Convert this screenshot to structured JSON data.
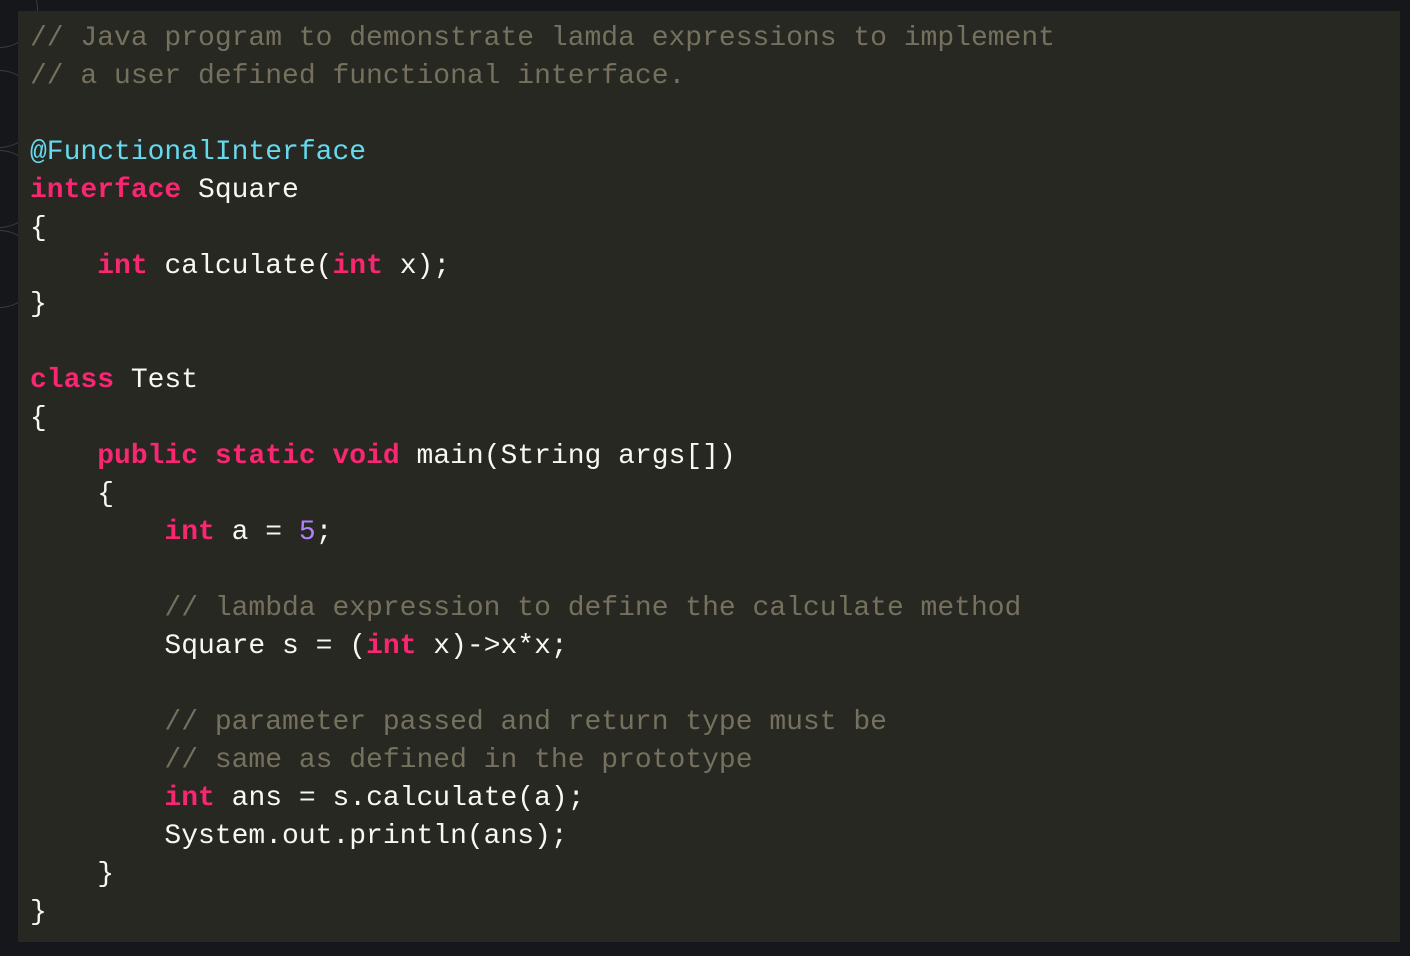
{
  "colors": {
    "background": "#15171a",
    "panel": "#272822",
    "text": "#f8f8f2",
    "comment": "#75715e",
    "keyword": "#f92672",
    "annotation": "#66d9ef",
    "number": "#ae81ff"
  },
  "code": {
    "lines": [
      [
        {
          "t": "comment",
          "s": "// Java program to demonstrate lamda expressions to implement"
        }
      ],
      [
        {
          "t": "comment",
          "s": "// a user defined functional interface."
        }
      ],
      [],
      [
        {
          "t": "annotation",
          "s": "@FunctionalInterface"
        }
      ],
      [
        {
          "t": "keyword",
          "s": "interface"
        },
        {
          "t": "plain",
          "s": " Square"
        }
      ],
      [
        {
          "t": "plain",
          "s": "{"
        }
      ],
      [
        {
          "t": "plain",
          "s": "    "
        },
        {
          "t": "keyword",
          "s": "int"
        },
        {
          "t": "plain",
          "s": " calculate("
        },
        {
          "t": "keyword",
          "s": "int"
        },
        {
          "t": "plain",
          "s": " x);"
        }
      ],
      [
        {
          "t": "plain",
          "s": "}"
        }
      ],
      [],
      [
        {
          "t": "keyword",
          "s": "class"
        },
        {
          "t": "plain",
          "s": " Test"
        }
      ],
      [
        {
          "t": "plain",
          "s": "{"
        }
      ],
      [
        {
          "t": "plain",
          "s": "    "
        },
        {
          "t": "keyword",
          "s": "public"
        },
        {
          "t": "plain",
          "s": " "
        },
        {
          "t": "keyword",
          "s": "static"
        },
        {
          "t": "plain",
          "s": " "
        },
        {
          "t": "keyword",
          "s": "void"
        },
        {
          "t": "plain",
          "s": " main(String args[])"
        }
      ],
      [
        {
          "t": "plain",
          "s": "    {"
        }
      ],
      [
        {
          "t": "plain",
          "s": "        "
        },
        {
          "t": "keyword",
          "s": "int"
        },
        {
          "t": "plain",
          "s": " a = "
        },
        {
          "t": "number",
          "s": "5"
        },
        {
          "t": "plain",
          "s": ";"
        }
      ],
      [],
      [
        {
          "t": "plain",
          "s": "        "
        },
        {
          "t": "comment",
          "s": "// lambda expression to define the calculate method"
        }
      ],
      [
        {
          "t": "plain",
          "s": "        Square s = ("
        },
        {
          "t": "keyword",
          "s": "int"
        },
        {
          "t": "plain",
          "s": " x)->x*x;"
        }
      ],
      [],
      [
        {
          "t": "plain",
          "s": "        "
        },
        {
          "t": "comment",
          "s": "// parameter passed and return type must be"
        }
      ],
      [
        {
          "t": "plain",
          "s": "        "
        },
        {
          "t": "comment",
          "s": "// same as defined in the prototype"
        }
      ],
      [
        {
          "t": "plain",
          "s": "        "
        },
        {
          "t": "keyword",
          "s": "int"
        },
        {
          "t": "plain",
          "s": " ans = s.calculate(a);"
        }
      ],
      [
        {
          "t": "plain",
          "s": "        System.out.println(ans);"
        }
      ],
      [
        {
          "t": "plain",
          "s": "    }"
        }
      ],
      [
        {
          "t": "plain",
          "s": "}"
        }
      ]
    ]
  }
}
